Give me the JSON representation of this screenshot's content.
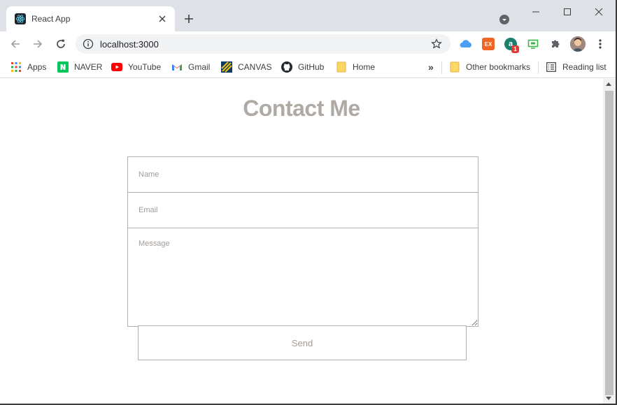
{
  "browser": {
    "tab": {
      "title": "React App",
      "favicon": "react-icon"
    },
    "window_controls": [
      "minimize-icon",
      "maximize-icon",
      "close-icon"
    ]
  },
  "toolbar": {
    "url": "localhost:3000",
    "extensions": [
      {
        "name": "cloud-extension-icon",
        "color": "#4a9ff5"
      },
      {
        "name": "ex-extension-icon",
        "label": "EX",
        "color": "#f06524"
      },
      {
        "name": "a-extension-icon",
        "label": "a",
        "badge": "1",
        "color": "#1a7f6e"
      },
      {
        "name": "screen-extension-icon",
        "color": "#3ab54a"
      }
    ]
  },
  "bookmarks": {
    "items": [
      {
        "label": "Apps",
        "icon": "apps-grid-icon"
      },
      {
        "label": "NAVER",
        "icon": "naver-icon",
        "color": "#03c75a"
      },
      {
        "label": "YouTube",
        "icon": "youtube-icon",
        "color": "#ff0000"
      },
      {
        "label": "Gmail",
        "icon": "gmail-icon"
      },
      {
        "label": "CANVAS",
        "icon": "canvas-icon"
      },
      {
        "label": "GitHub",
        "icon": "github-icon"
      },
      {
        "label": "Home",
        "icon": "folder-icon"
      }
    ],
    "overflow": "»",
    "other": "Other bookmarks",
    "reading_list": "Reading list"
  },
  "page": {
    "heading": "Contact Me",
    "form": {
      "name_placeholder": "Name",
      "email_placeholder": "Email",
      "message_placeholder": "Message",
      "send_label": "Send"
    }
  },
  "colors": {
    "heading": "#b0aaa5",
    "border": "#b6b0ab",
    "placeholder": "#a29c97",
    "chrome_bg": "#dee1e6"
  }
}
